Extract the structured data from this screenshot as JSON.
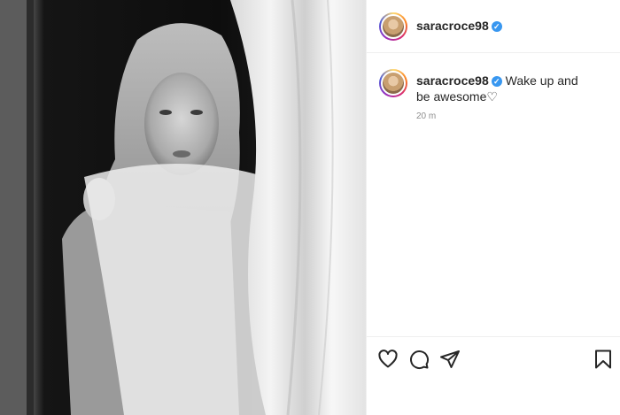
{
  "post": {
    "username": "saracroce98",
    "verified_icon": "verified-badge-icon",
    "caption_text": "Wake up and be awesome♡",
    "timestamp": "20 m"
  },
  "colors": {
    "verified_blue": "#3897f0",
    "muted_text": "#8e8e8e",
    "divider": "#efefef"
  },
  "icons": {
    "like": "heart-icon",
    "comment": "comment-icon",
    "share": "send-icon",
    "save": "bookmark-icon"
  }
}
